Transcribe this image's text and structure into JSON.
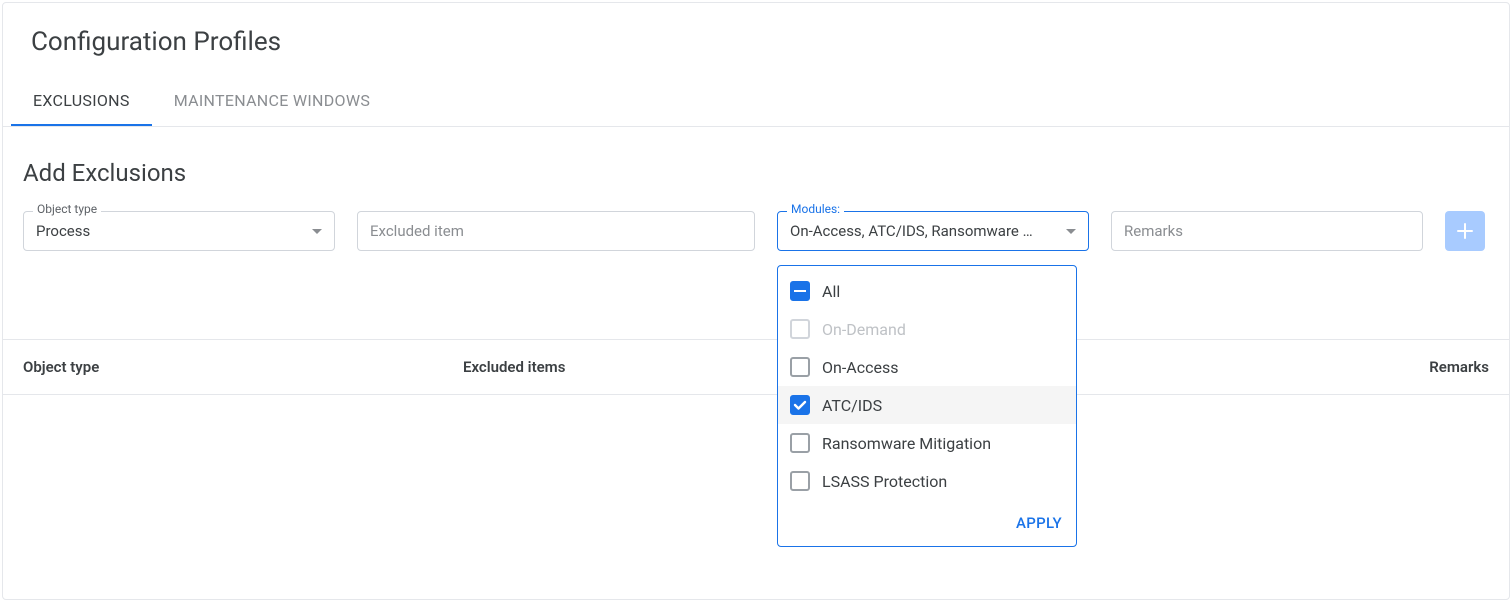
{
  "page_title": "Configuration Profiles",
  "tabs": [
    {
      "label": "EXCLUSIONS",
      "active": true
    },
    {
      "label": "MAINTENANCE WINDOWS",
      "active": false
    }
  ],
  "section_title": "Add Exclusions",
  "form": {
    "object_type": {
      "label": "Object type",
      "value": "Process"
    },
    "excluded_item": {
      "placeholder": "Excluded item"
    },
    "modules": {
      "label": "Modules:",
      "value": "On-Access, ATC/IDS, Ransomware …",
      "options": [
        {
          "label": "All",
          "state": "indeterminate",
          "disabled": false
        },
        {
          "label": "On-Demand",
          "state": "unchecked",
          "disabled": true
        },
        {
          "label": "On-Access",
          "state": "unchecked",
          "disabled": false
        },
        {
          "label": "ATC/IDS",
          "state": "checked",
          "disabled": false,
          "highlighted": true
        },
        {
          "label": "Ransomware Mitigation",
          "state": "unchecked",
          "disabled": false
        },
        {
          "label": "LSASS Protection",
          "state": "unchecked",
          "disabled": false
        }
      ],
      "apply_label": "APPLY"
    },
    "remarks": {
      "placeholder": "Remarks"
    }
  },
  "table": {
    "columns": {
      "object_type": "Object type",
      "excluded_items": "Excluded items",
      "remarks": "Remarks"
    }
  }
}
